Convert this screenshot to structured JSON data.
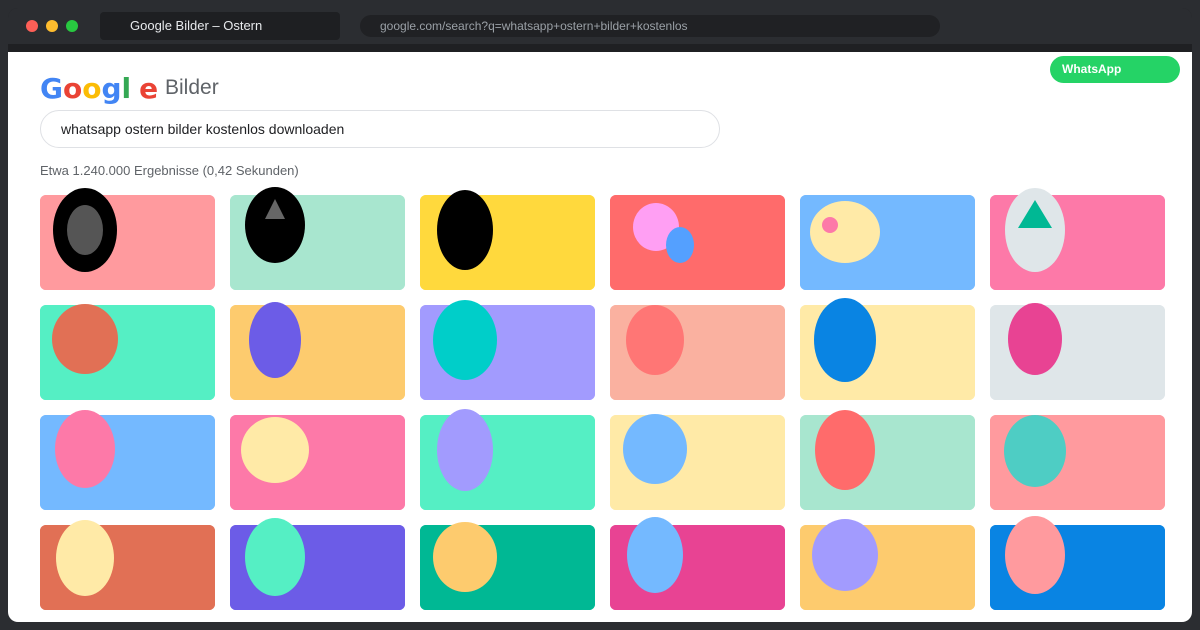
{
  "browser": {
    "tab_title": "Google Bilder – Ostern",
    "url": "google.com/search?q=whatsapp+ostern+bilder+kostenlos"
  },
  "logo": {
    "letters": [
      {
        "char": "G",
        "color": "#4285f4"
      },
      {
        "char": "o",
        "color": "#ea4335"
      },
      {
        "char": "o",
        "color": "#fbbc05"
      },
      {
        "char": "g",
        "color": "#4285f4"
      },
      {
        "char": "l",
        "color": "#34a853"
      },
      {
        "char": "e",
        "color": "#ea4335"
      }
    ],
    "sub": "Bilder"
  },
  "search": {
    "value": "whatsapp ostern bilder kostenlos downloaden"
  },
  "results": {
    "stats": "Etwa 1.240.000 Ergebnisse (0,42 Sekunden)"
  },
  "whatsapp_button": {
    "label": "WhatsApp"
  },
  "tiles": [
    {
      "bg": "#ff9a9e",
      "egg": "#000000",
      "inner": "#555555"
    },
    {
      "bg": "#a8e6cf",
      "egg": "#000000",
      "triangle": "#666666"
    },
    {
      "bg": "#ffd93d",
      "egg": "#000000"
    },
    {
      "bg": "#ff6b6b",
      "egg": "#ff9ff3",
      "extra": "#54a0ff"
    },
    {
      "bg": "#74b9ff",
      "egg": "#ffeaa7",
      "extra": "#fd79a8"
    },
    {
      "bg": "#fd79a8",
      "egg": "#dfe6e9",
      "triangle": "#00b894"
    },
    {
      "bg": "#55efc4",
      "egg": "#e17055"
    },
    {
      "bg": "#fdcb6e",
      "egg": "#6c5ce7"
    },
    {
      "bg": "#a29bfe",
      "egg": "#00cec9"
    },
    {
      "bg": "#fab1a0",
      "egg": "#ff7675"
    },
    {
      "bg": "#ffeaa7",
      "egg": "#0984e3"
    },
    {
      "bg": "#dfe6e9",
      "egg": "#e84393"
    },
    {
      "bg": "#74b9ff",
      "egg": "#fd79a8"
    },
    {
      "bg": "#fd79a8",
      "egg": "#ffeaa7"
    },
    {
      "bg": "#55efc4",
      "egg": "#a29bfe"
    },
    {
      "bg": "#ffeaa7",
      "egg": "#74b9ff"
    },
    {
      "bg": "#a8e6cf",
      "egg": "#ff6b6b"
    },
    {
      "bg": "#ff9a9e",
      "egg": "#4ecdc4"
    },
    {
      "bg": "#e17055",
      "egg": "#ffeaa7"
    },
    {
      "bg": "#6c5ce7",
      "egg": "#55efc4"
    },
    {
      "bg": "#00b894",
      "egg": "#fdcb6e"
    },
    {
      "bg": "#e84393",
      "egg": "#74b9ff"
    },
    {
      "bg": "#fdcb6e",
      "egg": "#a29bfe"
    },
    {
      "bg": "#0984e3",
      "egg": "#ff9a9e"
    }
  ]
}
